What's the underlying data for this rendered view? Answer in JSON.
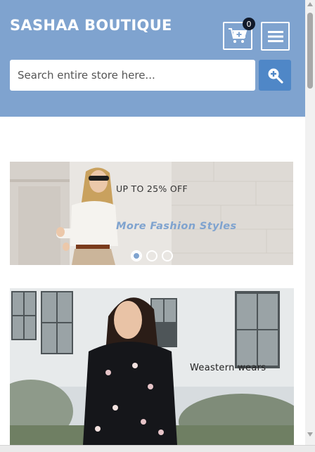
{
  "header": {
    "brand": "SASHAA BOUTIQUE",
    "cart_count": "0",
    "search_placeholder": "Search entire store here..."
  },
  "banner1": {
    "promo": "UP TO 25% OFF",
    "tagline": "More Fashion Styles",
    "active_slide": 1,
    "slide_count": 3
  },
  "banner2": {
    "caption": "Weastern wears"
  },
  "colors": {
    "header_bg": "#7fa3cf",
    "search_button": "#4f87c7",
    "tagline": "#7fa3cf",
    "badge": "#111a2b"
  },
  "icons": {
    "cart": "cart-plus-icon",
    "menu": "hamburger-menu-icon",
    "search": "search-plus-icon"
  }
}
